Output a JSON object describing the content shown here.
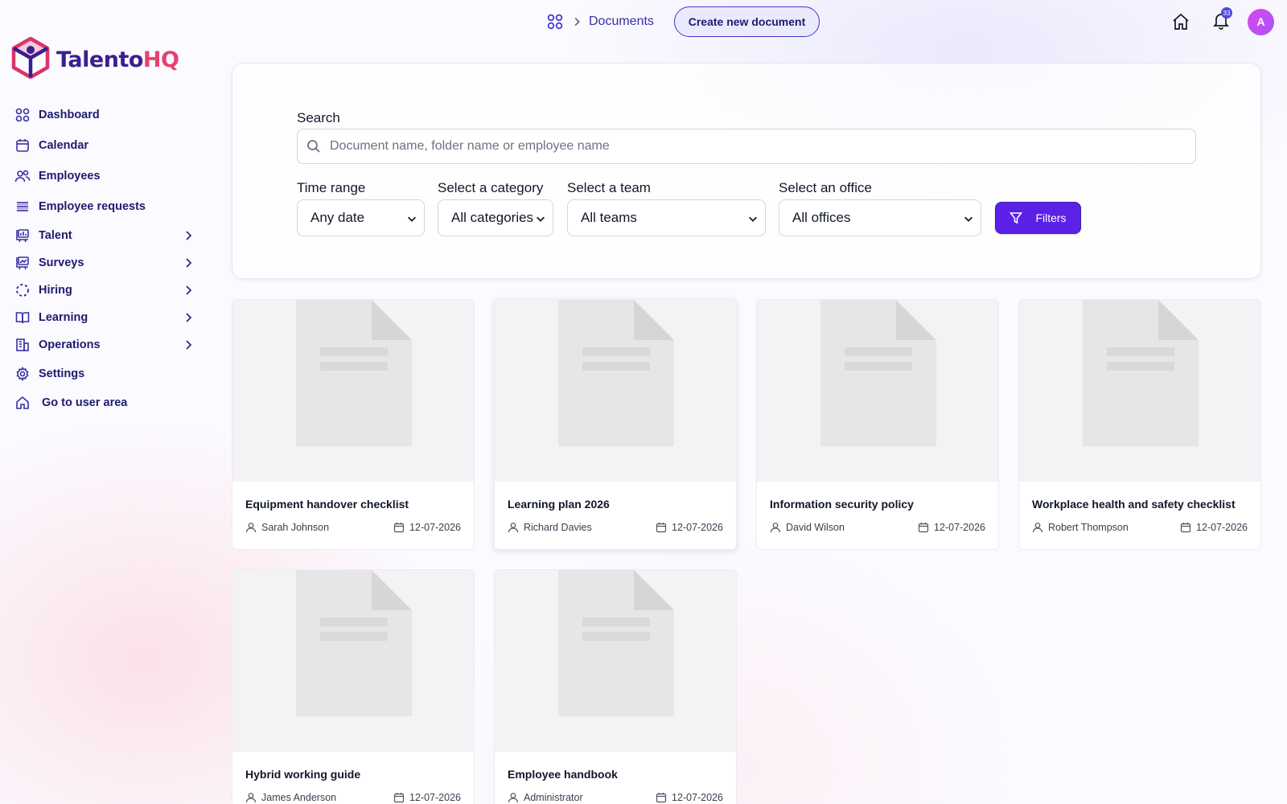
{
  "brand": {
    "name_part1": "Talento",
    "name_part2": "HQ"
  },
  "sidebar": {
    "items": [
      {
        "label": "Dashboard",
        "icon": "grid-icon",
        "expandable": false
      },
      {
        "label": "Calendar",
        "icon": "calendar-icon",
        "expandable": false
      },
      {
        "label": "Employees",
        "icon": "users-icon",
        "expandable": false
      },
      {
        "label": "Employee requests",
        "icon": "list-icon",
        "expandable": false
      },
      {
        "label": "Talent",
        "icon": "presentation-chart-icon",
        "expandable": true
      },
      {
        "label": "Surveys",
        "icon": "presentation-chart-icon",
        "expandable": true
      },
      {
        "label": "Hiring",
        "icon": "dashed-circle-icon",
        "expandable": true
      },
      {
        "label": "Learning",
        "icon": "book-icon",
        "expandable": true
      },
      {
        "label": "Operations",
        "icon": "building-icon",
        "expandable": true
      },
      {
        "label": "Settings",
        "icon": "gear-icon",
        "expandable": false
      },
      {
        "label": "Go to user area",
        "icon": "home-icon",
        "expandable": false
      }
    ]
  },
  "header": {
    "breadcrumb": {
      "current": "Documents"
    },
    "create_button": "Create new document",
    "notifications_count": "33",
    "avatar_initial": "A"
  },
  "filters": {
    "search_label": "Search",
    "search_placeholder": "Document name, folder name or employee name",
    "search_value": "",
    "time_range": {
      "label": "Time range",
      "selected": "Any date"
    },
    "category": {
      "label": "Select a category",
      "selected": "All categories"
    },
    "team": {
      "label": "Select a team",
      "selected": "All teams"
    },
    "office": {
      "label": "Select an office",
      "selected": "All offices"
    },
    "filters_button": "Filters"
  },
  "documents": [
    {
      "title": "Equipment handover checklist",
      "author": "Sarah Johnson",
      "date": "12-07-2026"
    },
    {
      "title": "Learning plan 2026",
      "author": "Richard Davies",
      "date": "12-07-2026"
    },
    {
      "title": "Information security policy",
      "author": "David Wilson",
      "date": "12-07-2026"
    },
    {
      "title": "Workplace health and safety checklist",
      "author": "Robert Thompson",
      "date": "12-07-2026"
    },
    {
      "title": "Hybrid working guide",
      "author": "James Anderson",
      "date": "12-07-2026"
    },
    {
      "title": "Employee handbook",
      "author": "Administrator",
      "date": "12-07-2026"
    }
  ],
  "colors": {
    "primary": "#5b21e6",
    "brand_dark": "#3b1f8f",
    "brand_accent": "#e8416f",
    "nav_text": "#1e1b6f"
  }
}
